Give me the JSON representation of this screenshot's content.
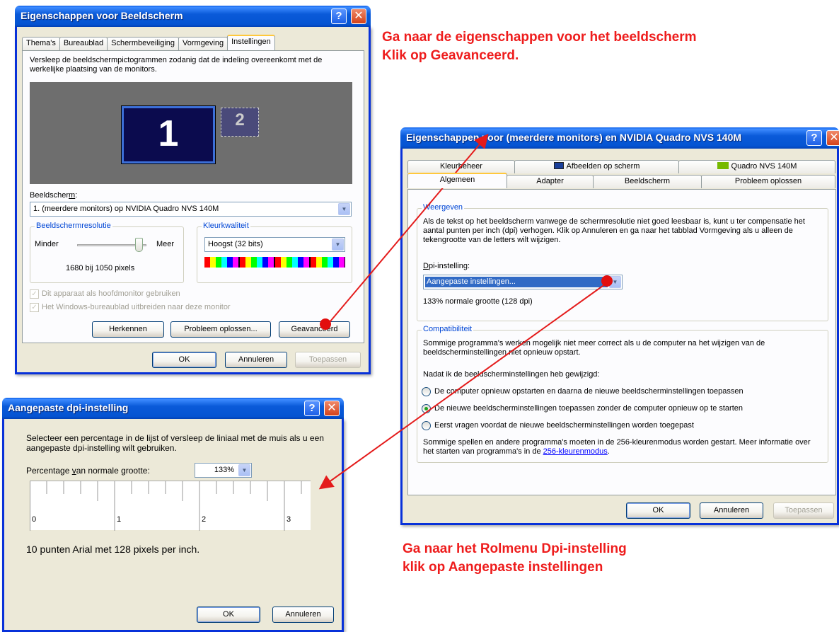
{
  "win1": {
    "title": "Eigenschappen voor Beeldscherm",
    "tabs": [
      "Thema's",
      "Bureaublad",
      "Schermbeveiliging",
      "Vormgeving",
      "Instellingen"
    ],
    "instructions": "Versleep de beeldschermpictogrammen zodanig dat de indeling overeenkomt met de werkelijke plaatsing van de monitors.",
    "monitor1": "1",
    "monitor2": "2",
    "display_label": "Beeldscherm:",
    "display_value": "1. (meerdere monitors) op NVIDIA Quadro NVS 140M",
    "resolution_group": "Beeldschermresolutie",
    "resolution_less": "Minder",
    "resolution_more": "Meer",
    "resolution_value": "1680 bij 1050 pixels",
    "color_group": "Kleurkwaliteit",
    "color_value": "Hoogst (32 bits)",
    "check_primary": "Dit apparaat als hoofdmonitor gebruiken",
    "check_extend": "Het Windows-bureaublad uitbreiden naar deze monitor",
    "btn_identify": "Herkennen",
    "btn_troubleshoot": "Probleem oplossen...",
    "btn_advanced": "Geavanceerd",
    "btn_ok": "OK",
    "btn_cancel": "Annuleren",
    "btn_apply": "Toepassen"
  },
  "win2": {
    "title": "Eigenschappen voor (meerdere monitors) en NVIDIA Quadro NVS 140M",
    "tabs_row1": [
      "Kleurbeheer",
      "Afbeelden op scherm",
      "Quadro NVS 140M"
    ],
    "tabs_row2": [
      "Algemeen",
      "Adapter",
      "Beeldscherm",
      "Probleem oplossen"
    ],
    "display_group": "Weergeven",
    "display_text": "Als de tekst op het beeldscherm vanwege de schermresolutie niet goed leesbaar is, kunt u ter compensatie het aantal punten per inch (dpi) verhogen. Klik op Annuleren en ga naar het tabblad Vormgeving als u alleen de tekengrootte van de letters wilt wijzigen.",
    "dpi_label": "Dpi-instelling:",
    "dpi_value": "Aangepaste instellingen...",
    "dpi_note": "133% normale grootte (128 dpi)",
    "compat_group": "Compatibiliteit",
    "compat_text": "Sommige programma's werken mogelijk niet meer correct als u de computer na het wijzigen van de beeldscherminstellingen niet opnieuw opstart.",
    "after_change": "Nadat ik de beeldscherminstellingen heb gewijzigd:",
    "radio1": "De computer opnieuw opstarten en daarna de nieuwe beeldscherminstellingen toepassen",
    "radio2": "De nieuwe beeldscherminstellingen toepassen zonder de computer opnieuw op te starten",
    "radio3": "Eerst vragen voordat de nieuwe beeldscherminstellingen worden toegepast",
    "games_text": "Sommige spellen en andere programma's moeten in de 256-kleurenmodus worden gestart. Meer informatie over het starten van programma's in de",
    "games_link": "256-kleurenmodus",
    "btn_ok": "OK",
    "btn_cancel": "Annuleren",
    "btn_apply": "Toepassen"
  },
  "win3": {
    "title": "Aangepaste dpi-instelling",
    "instructions": "Selecteer een percentage in de lijst of versleep de liniaal met de muis als u een aangepaste dpi-instelling wilt gebruiken.",
    "percent_label": "Percentage van normale grootte:",
    "percent_value": "133%",
    "ruler_labels": [
      "0",
      "1",
      "2",
      "3"
    ],
    "sample_text": "10 punten Arial met 128 pixels per inch.",
    "btn_ok": "OK",
    "btn_cancel": "Annuleren"
  },
  "annotations": {
    "top_line1": "Ga naar de eigenschappen voor het beeldscherm",
    "top_line2": "Klik op Geavanceerd.",
    "bottom_line1": "Ga naar het Rolmenu Dpi-instelling",
    "bottom_line2": "klik op Aangepaste instellingen"
  },
  "colors": {
    "annotation_red": "#ee1c1c",
    "xp_blue": "#0a5ad9",
    "monitor_navy": "#0b0b4e"
  }
}
